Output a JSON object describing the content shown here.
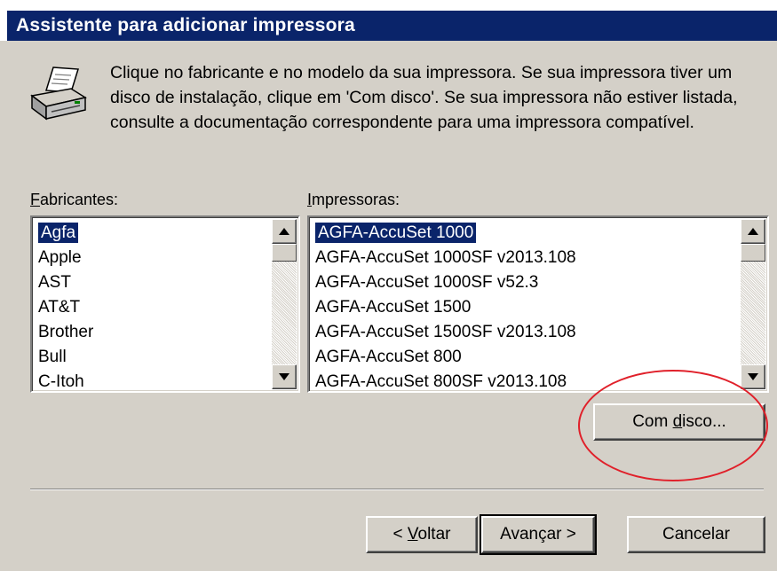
{
  "window": {
    "title": "Assistente para adicionar impressora"
  },
  "intro_text": "Clique no fabricante e no modelo da sua impressora. Se sua impressora tiver um disco de instalação, clique em 'Com disco'. Se sua impressora não estiver listada, consulte a documentação correspondente para uma impressora compatível.",
  "manufacturers": {
    "label_mnemonic": "F",
    "label_rest": "abricantes:",
    "items": [
      "Agfa",
      "Apple",
      "AST",
      "AT&T",
      "Brother",
      "Bull",
      "C-Itoh"
    ],
    "selected": "Agfa"
  },
  "printers": {
    "label_mnemonic": "I",
    "label_rest": "mpressoras:",
    "items": [
      "AGFA-AccuSet 1000",
      "AGFA-AccuSet 1000SF v2013.108",
      "AGFA-AccuSet 1000SF v52.3",
      "AGFA-AccuSet 1500",
      "AGFA-AccuSet 1500SF v2013.108",
      "AGFA-AccuSet 800",
      "AGFA-AccuSet 800SF v2013.108"
    ],
    "selected": "AGFA-AccuSet 1000"
  },
  "buttons": {
    "have_disk_pre": "Com ",
    "have_disk_mnemonic": "d",
    "have_disk_post": "isco...",
    "back_pre": "< ",
    "back_mnemonic": "V",
    "back_post": "oltar",
    "next": "Avançar >",
    "cancel": "Cancelar"
  },
  "colors": {
    "dialog_face": "#d4d0c8",
    "titlebar": "#0a246a",
    "selection": "#0a246a",
    "annotation": "#e0202a"
  },
  "icons": [
    "printer-icon",
    "scroll-up-icon",
    "scroll-down-icon"
  ]
}
